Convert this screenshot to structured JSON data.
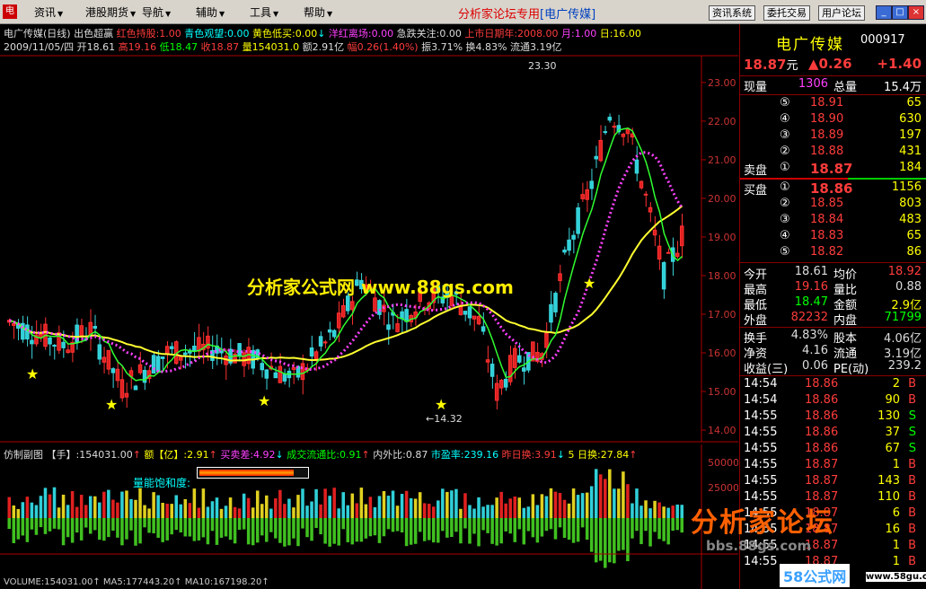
{
  "menu": {
    "items": [
      "资讯",
      "港股期货",
      "导航",
      "辅助",
      "工具",
      "帮助"
    ],
    "title_red": "分析家论坛专用",
    "title_blue": "[电广传媒]",
    "right_buttons": [
      "资讯系统",
      "委托交易",
      "用户论坛"
    ]
  },
  "chart": {
    "info_line1": [
      {
        "t": "电广传媒(日线)",
        "c": "wt"
      },
      {
        "t": " 出色超赢 ",
        "c": "wt"
      },
      {
        "t": "红色持股:1.00",
        "c": "rd"
      },
      {
        "t": " 青色观望:0.00",
        "c": "cy"
      },
      {
        "t": " 黄色低买:0.00",
        "c": "yl"
      },
      {
        "t": "↓",
        "c": "cy"
      },
      {
        "t": " 洋红离场:0.00",
        "c": "mg"
      },
      {
        "t": " 急跌关注:0.00",
        "c": "wt"
      },
      {
        "t": " 上市日期年:2008.00",
        "c": "rd"
      },
      {
        "t": " 月:1.00",
        "c": "mg"
      },
      {
        "t": " 日:16.00",
        "c": "yl"
      }
    ],
    "info_line2": [
      {
        "t": "2009/11/05/四 开18.61 ",
        "c": "wt"
      },
      {
        "t": "高19.16 ",
        "c": "rd"
      },
      {
        "t": "低18.47 ",
        "c": "gr"
      },
      {
        "t": "收18.87 ",
        "c": "rd"
      },
      {
        "t": "量154031.0 ",
        "c": "yl"
      },
      {
        "t": "额2.91亿 ",
        "c": "wt"
      },
      {
        "t": "幅0.26(1.40%) ",
        "c": "rd"
      },
      {
        "t": "振3.71% 换4.83% 流通3.19亿",
        "c": "wt"
      }
    ],
    "y_labels": [
      "23.00",
      "22.00",
      "21.00",
      "20.00",
      "19.00",
      "18.00",
      "17.00",
      "16.00",
      "15.00",
      "14.00"
    ],
    "high_label": "23.30",
    "low_label": "←14.32",
    "watermark_main": "分析家公式网 www.88gs.com",
    "sub_header": [
      {
        "t": "仿制副图 ",
        "c": "wt"
      },
      {
        "t": "【手】:154031.00",
        "c": "wt"
      },
      {
        "t": "↑ ",
        "c": "rd"
      },
      {
        "t": "  额【亿】:2.91",
        "c": "yl"
      },
      {
        "t": "↑ ",
        "c": "rd"
      },
      {
        "t": " 买卖差:4.92",
        "c": "mg"
      },
      {
        "t": "↓ ",
        "c": "cy"
      },
      {
        "t": " 成交流通比:0.91",
        "c": "gr"
      },
      {
        "t": "↑ ",
        "c": "rd"
      },
      {
        "t": " 内外比:0.87 ",
        "c": "wt"
      },
      {
        "t": "市盈率:239.16 ",
        "c": "cy"
      },
      {
        "t": " 昨日换:3.91",
        "c": "rd"
      },
      {
        "t": "↓ ",
        "c": "cy"
      },
      {
        "t": " 5 日换:27.84",
        "c": "yl"
      },
      {
        "t": "↑",
        "c": "rd"
      }
    ],
    "gauge_label": "量能饱和度:",
    "gauge_fill": 0.88,
    "vol_labels": [
      "50000",
      "25000"
    ],
    "bottom_labels": "VOLUME:154031.00↑  MA5:177443.20↑  MA10:167198.20↑"
  },
  "panel": {
    "name": "电广传媒",
    "code": "000917",
    "price": "18.87",
    "price_unit": "元",
    "change_pct": "▲0.26",
    "change_amt": "+1.40",
    "xianliang_label": "现量",
    "xianliang": "1306",
    "zongliang_label": "总量",
    "zongliang": "15.4万",
    "sell_label": "卖盘",
    "buy_label": "买盘",
    "sell": [
      {
        "i": "⑤",
        "p": "18.91",
        "v": "65"
      },
      {
        "i": "④",
        "p": "18.90",
        "v": "630"
      },
      {
        "i": "③",
        "p": "18.89",
        "v": "197"
      },
      {
        "i": "②",
        "p": "18.88",
        "v": "431"
      },
      {
        "i": "①",
        "p": "18.87",
        "v": "184"
      }
    ],
    "buy": [
      {
        "i": "①",
        "p": "18.86",
        "v": "1156"
      },
      {
        "i": "②",
        "p": "18.85",
        "v": "803"
      },
      {
        "i": "③",
        "p": "18.84",
        "v": "483"
      },
      {
        "i": "④",
        "p": "18.83",
        "v": "65"
      },
      {
        "i": "⑤",
        "p": "18.82",
        "v": "86"
      }
    ],
    "stats": [
      {
        "k1": "今开",
        "v1": "18.61",
        "c1": "wt",
        "k2": "均价",
        "v2": "18.92",
        "c2": "rd"
      },
      {
        "k1": "最高",
        "v1": "19.16",
        "c1": "rd",
        "k2": "量比",
        "v2": "0.88",
        "c2": "wt"
      },
      {
        "k1": "最低",
        "v1": "18.47",
        "c1": "gr",
        "k2": "金额",
        "v2": "2.9亿",
        "c2": "yl"
      },
      {
        "k1": "外盘",
        "v1": "82232",
        "c1": "rd",
        "k2": "内盘",
        "v2": "71799",
        "c2": "gr"
      },
      {
        "k1": "换手",
        "v1": "4.83%",
        "c1": "wt",
        "k2": "股本",
        "v2": "4.06亿",
        "c2": "wt"
      },
      {
        "k1": "净资",
        "v1": "4.16",
        "c1": "wt",
        "k2": "流通",
        "v2": "3.19亿",
        "c2": "wt"
      },
      {
        "k1": "收益(三)",
        "v1": "0.06",
        "c1": "wt",
        "k2": "PE(动)",
        "v2": "239.2",
        "c2": "wt"
      }
    ],
    "ticks": [
      {
        "t": "14:54",
        "p": "18.86",
        "v": "2",
        "s": "B"
      },
      {
        "t": "14:54",
        "p": "18.86",
        "v": "90",
        "s": "B"
      },
      {
        "t": "14:55",
        "p": "18.86",
        "v": "130",
        "s": "S"
      },
      {
        "t": "14:55",
        "p": "18.86",
        "v": "37",
        "s": "S"
      },
      {
        "t": "14:55",
        "p": "18.86",
        "v": "67",
        "s": "S"
      },
      {
        "t": "14:55",
        "p": "18.87",
        "v": "1",
        "s": "B"
      },
      {
        "t": "14:55",
        "p": "18.87",
        "v": "143",
        "s": "B"
      },
      {
        "t": "14:55",
        "p": "18.87",
        "v": "110",
        "s": "B"
      },
      {
        "t": "14:55",
        "p": "18.87",
        "v": "6",
        "s": "B"
      },
      {
        "t": "14:55",
        "p": "18.87",
        "v": "16",
        "s": "B"
      },
      {
        "t": "14:55",
        "p": "18.87",
        "v": "1",
        "s": "B"
      },
      {
        "t": "14:55",
        "p": "18.87",
        "v": "1",
        "s": "B"
      }
    ]
  },
  "watermarks": {
    "logo": "分析家论坛",
    "url": "bbs.88gs.com",
    "corner": "58公式网",
    "corner_url": "www.58gu.com"
  }
}
